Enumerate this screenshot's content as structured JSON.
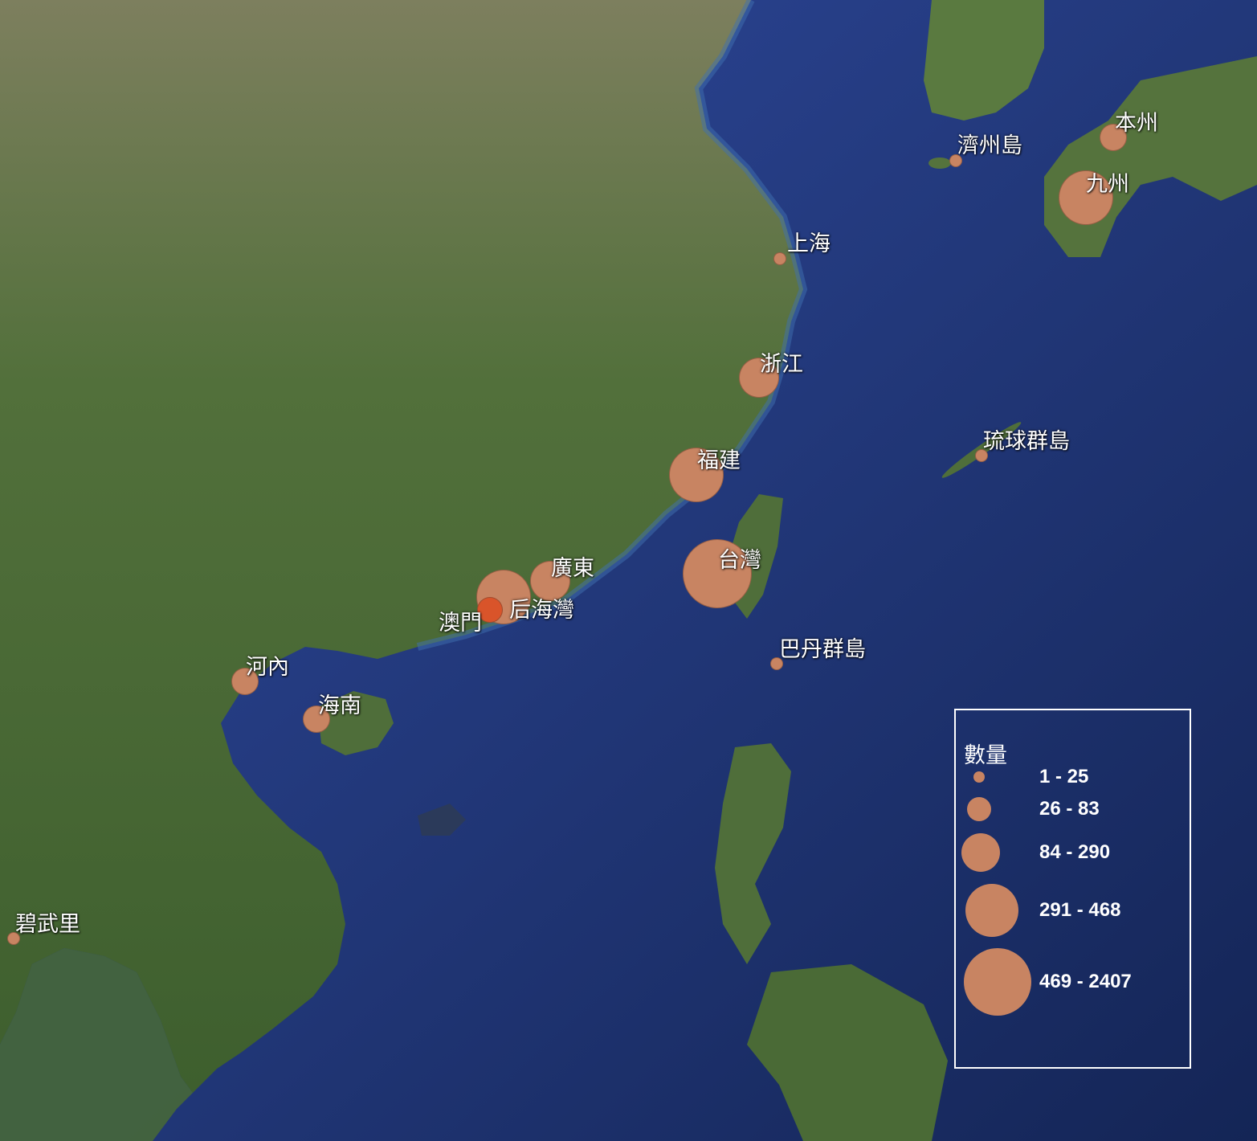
{
  "map": {
    "places": [
      {
        "id": "honshu",
        "name": "本州",
        "count_class": 2
      },
      {
        "id": "jeju",
        "name": "濟州島",
        "count_class": 1
      },
      {
        "id": "kyushu",
        "name": "九州",
        "count_class": 4
      },
      {
        "id": "shanghai",
        "name": "上海",
        "count_class": 1
      },
      {
        "id": "zhejiang",
        "name": "浙江",
        "count_class": 3
      },
      {
        "id": "ryukyu",
        "name": "琉球群島",
        "count_class": 1
      },
      {
        "id": "fujian",
        "name": "福建",
        "count_class": 4
      },
      {
        "id": "taiwan",
        "name": "台灣",
        "count_class": 5
      },
      {
        "id": "guangdong",
        "name": "廣東",
        "count_class": 3
      },
      {
        "id": "houhaiwan",
        "name": "后海灣",
        "count_class": 4
      },
      {
        "id": "macau",
        "name": "澳門",
        "count_class": 2
      },
      {
        "id": "batanes",
        "name": "巴丹群島",
        "count_class": 1
      },
      {
        "id": "hanoi",
        "name": "河內",
        "count_class": 2
      },
      {
        "id": "hainan",
        "name": "海南",
        "count_class": 2
      },
      {
        "id": "pattani",
        "name": "碧武里",
        "count_class": 1
      }
    ]
  },
  "legend": {
    "title": "數量",
    "classes": [
      {
        "label": "1 - 25"
      },
      {
        "label": "26 - 83"
      },
      {
        "label": "84 - 290"
      },
      {
        "label": "291 - 468"
      },
      {
        "label": "469 - 2407"
      }
    ]
  },
  "colors": {
    "marker": "#c88462",
    "marker_highlight": "#d9542a",
    "ocean": "#1f3570",
    "land": "#4a6a34"
  }
}
